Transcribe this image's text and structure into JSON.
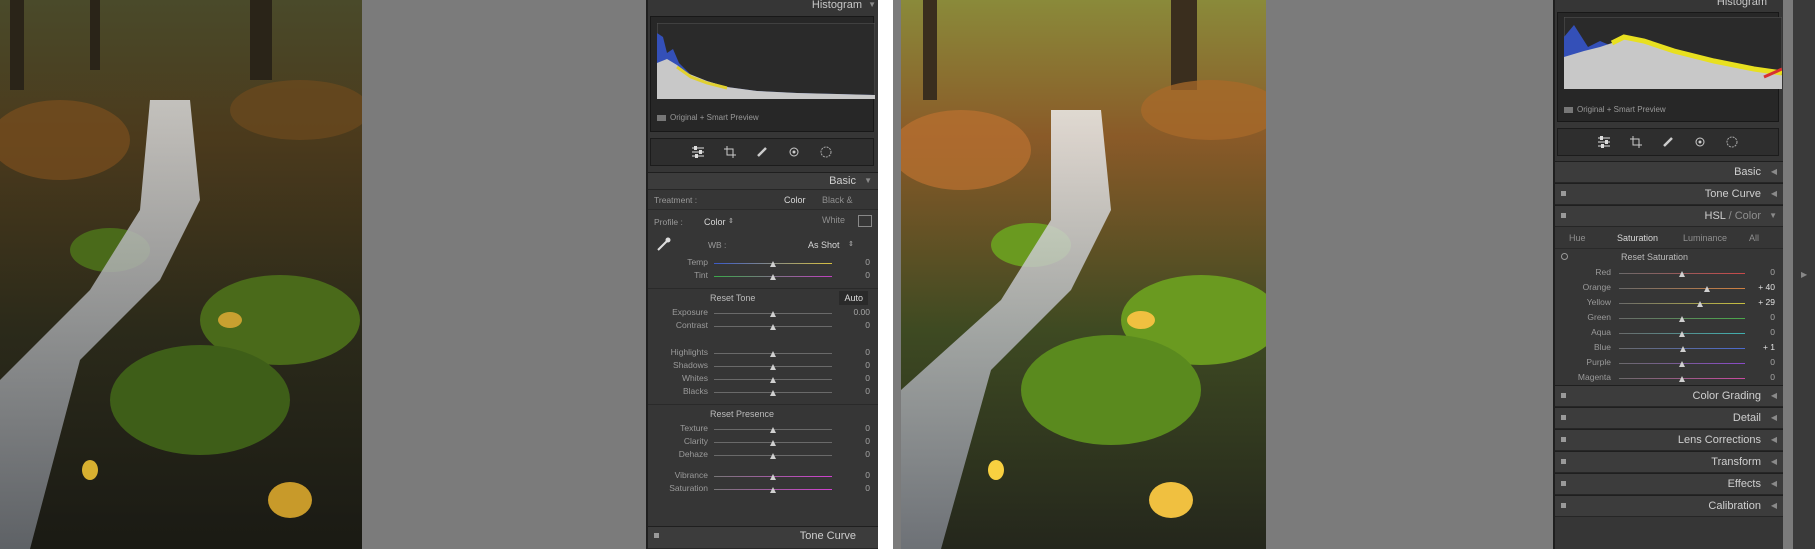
{
  "left": {
    "histogram_title": "Histogram",
    "histogram_status": "Original + Smart Preview",
    "basic": {
      "title": "Basic",
      "treatment_label": "Treatment :",
      "treatment_color": "Color",
      "treatment_bw": "Black & White",
      "profile_label": "Profile :",
      "profile_value": "Color",
      "wb_label": "WB :",
      "wb_value": "As Shot",
      "temp": {
        "label": "Temp",
        "value": "0"
      },
      "tint": {
        "label": "Tint",
        "value": "0"
      },
      "reset_tone": "Reset Tone",
      "auto": "Auto",
      "exposure": {
        "label": "Exposure",
        "value": "0.00"
      },
      "contrast": {
        "label": "Contrast",
        "value": "0"
      },
      "highlights": {
        "label": "Highlights",
        "value": "0"
      },
      "shadows": {
        "label": "Shadows",
        "value": "0"
      },
      "whites": {
        "label": "Whites",
        "value": "0"
      },
      "blacks": {
        "label": "Blacks",
        "value": "0"
      },
      "reset_presence": "Reset Presence",
      "texture": {
        "label": "Texture",
        "value": "0"
      },
      "clarity": {
        "label": "Clarity",
        "value": "0"
      },
      "dehaze": {
        "label": "Dehaze",
        "value": "0"
      },
      "vibrance": {
        "label": "Vibrance",
        "value": "0"
      },
      "saturation": {
        "label": "Saturation",
        "value": "0"
      }
    },
    "tone_curve": "Tone Curve"
  },
  "right": {
    "histogram_title": "Histogram",
    "histogram_status": "Original + Smart Preview",
    "sections": {
      "basic": "Basic",
      "tone_curve": "Tone Curve",
      "hsl": "HSL",
      "hsl_sep": "/",
      "color": "Color",
      "color_grading": "Color Grading",
      "detail": "Detail",
      "lens_corrections": "Lens Corrections",
      "transform": "Transform",
      "effects": "Effects",
      "calibration": "Calibration"
    },
    "hsl_tabs": [
      "Hue",
      "Saturation",
      "Luminance",
      "All"
    ],
    "reset_saturation": "Reset Saturation",
    "sliders": [
      {
        "label": "Red",
        "value": "0",
        "pos": 0.5,
        "color": "#c84a4a"
      },
      {
        "label": "Orange",
        "value": "+ 40",
        "pos": 0.7,
        "color": "#d08040"
      },
      {
        "label": "Yellow",
        "value": "+ 29",
        "pos": 0.645,
        "color": "#c8c040"
      },
      {
        "label": "Green",
        "value": "0",
        "pos": 0.5,
        "color": "#4aa84a"
      },
      {
        "label": "Aqua",
        "value": "0",
        "pos": 0.5,
        "color": "#40b0b0"
      },
      {
        "label": "Blue",
        "value": "+ 1",
        "pos": 0.505,
        "color": "#4a6ad0"
      },
      {
        "label": "Purple",
        "value": "0",
        "pos": 0.5,
        "color": "#8a4ac8"
      },
      {
        "label": "Magenta",
        "value": "0",
        "pos": 0.5,
        "color": "#c84aa0"
      }
    ]
  },
  "colors": {
    "panel_bg": "#363636",
    "canvas_bg": "#7b7b7b",
    "accent_text": "#d8d8d8"
  }
}
